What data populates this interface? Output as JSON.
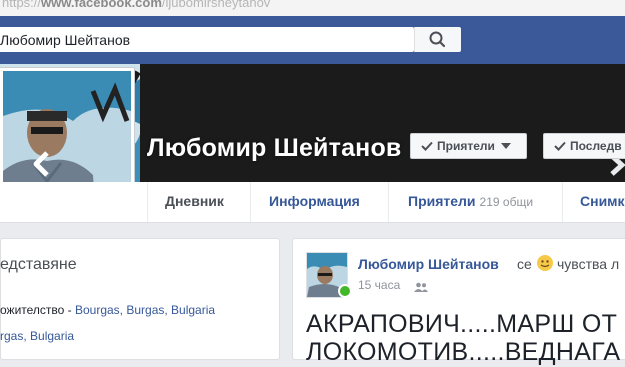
{
  "browser": {
    "url_prefix": "https://",
    "url_domain": "www.facebook.com",
    "url_path": "/ljubomirsheytanov"
  },
  "header": {
    "search_value": "Любомир Шейтанов"
  },
  "profile": {
    "name": "Любомир Шейтанов",
    "friends_button": "Приятели",
    "last_button": "Последв"
  },
  "tabs": [
    {
      "label": "Дневник"
    },
    {
      "label": "Информация"
    },
    {
      "label": "Приятели",
      "count": "219 общи"
    },
    {
      "label": "Снимк"
    }
  ],
  "intro": {
    "title": "едставяне",
    "line1_label": "ожителство - ",
    "line1_link": "Bourgas, Burgas, Bulgaria",
    "line2_link": "rgas, Bulgaria"
  },
  "post": {
    "author": "Любомир Шейтанов",
    "verb": "се",
    "feeling": "чувства л",
    "time": "15 часа",
    "text_line1": "АКРАПОВИЧ.....МАРШ ОТ",
    "text_line2": "ЛОКОМОТИВ.....ВЕДНАГА"
  },
  "colors": {
    "brand_blue": "#3b5998",
    "link": "#365899",
    "online": "#42b72a"
  }
}
